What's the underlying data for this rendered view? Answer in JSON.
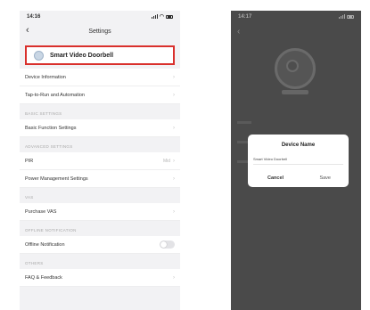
{
  "left": {
    "status": {
      "time": "14:16"
    },
    "nav": {
      "title": "Settings"
    },
    "device": {
      "name": "Smart Video Doorbell"
    },
    "rows_top": [
      {
        "label": "Device Information"
      },
      {
        "label": "Tap-to-Run and Automation"
      }
    ],
    "sections": [
      {
        "header": "BASIC SETTINGS",
        "rows": [
          {
            "label": "Basic Function Settings",
            "value": ""
          }
        ]
      },
      {
        "header": "ADVANCED SETTINGS",
        "rows": [
          {
            "label": "PIR",
            "value": "Mid"
          },
          {
            "label": "Power Management Settings",
            "value": ""
          }
        ]
      },
      {
        "header": "VAS",
        "rows": [
          {
            "label": "Purchase VAS",
            "value": ""
          }
        ]
      }
    ],
    "offline": {
      "header": "OFFLINE NOTIFICATION",
      "label": "Offline Notification",
      "enabled": false
    },
    "others": {
      "header": "OTHERS",
      "label": "FAQ & Feedback"
    }
  },
  "right": {
    "status": {
      "time": "14:17"
    },
    "dialog": {
      "title": "Device Name",
      "input_value": "Smart Video Doorbell",
      "cancel": "Cancel",
      "save": "Save"
    }
  }
}
